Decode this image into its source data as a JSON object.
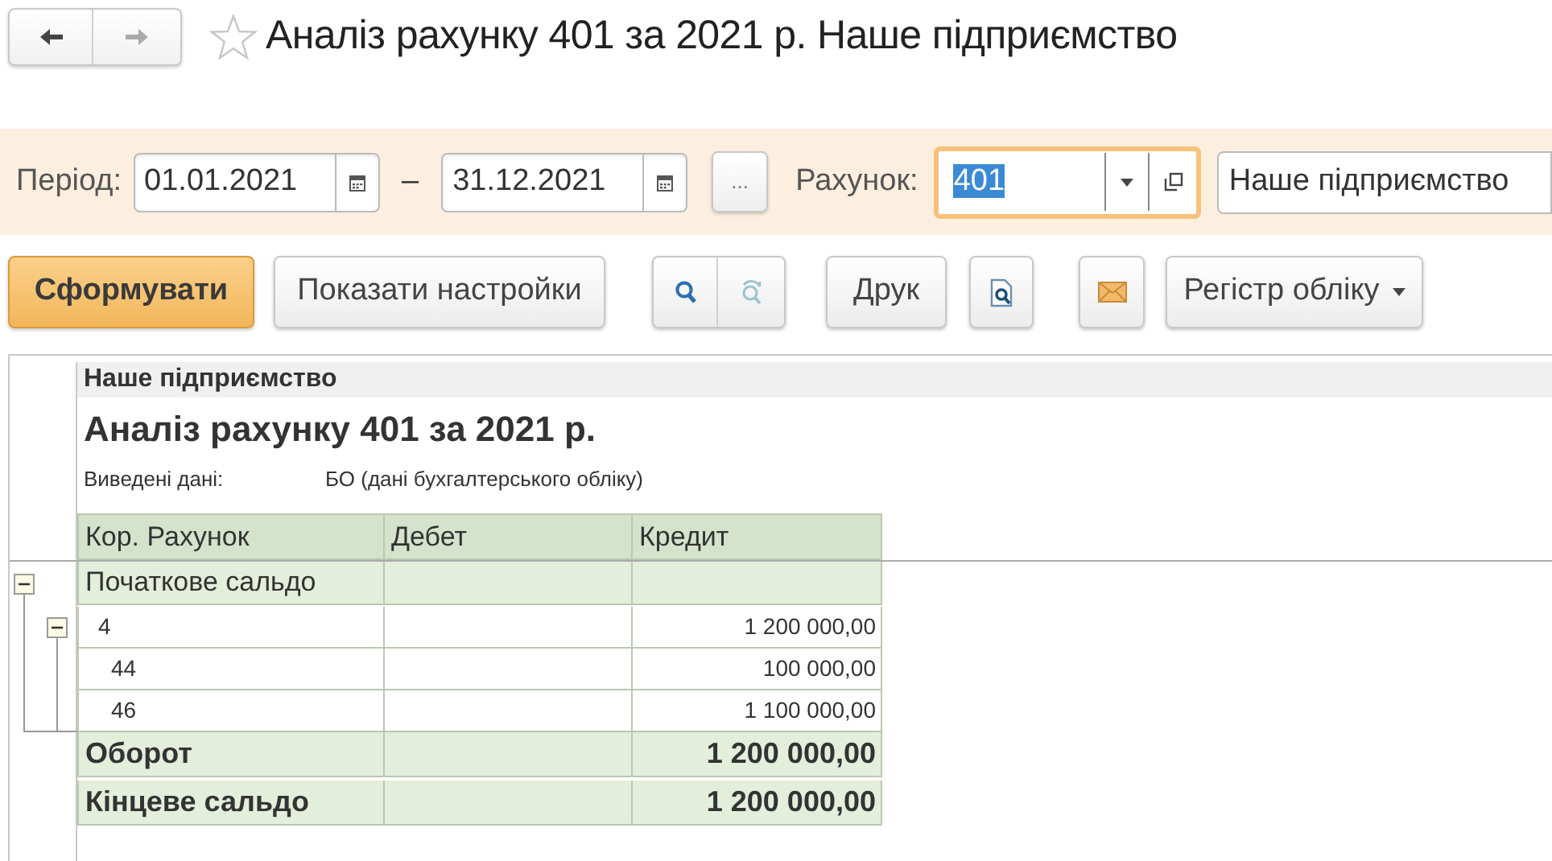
{
  "window": {
    "title": "Аналіз рахунку 401 за 2021 р. Наше підприємство",
    "favorite": false
  },
  "filters": {
    "period_label": "Період:",
    "date_from": "01.01.2021",
    "separator": "–",
    "date_to": "31.12.2021",
    "more_button": "...",
    "account_label": "Рахунок:",
    "account": "401",
    "account_selected": true,
    "organization": "Наше підприємство"
  },
  "toolbar": {
    "generate": "Сформувати",
    "settings": "Показати настройки",
    "print": "Друк",
    "register": "Регістр обліку"
  },
  "report": {
    "organization": "Наше підприємство",
    "title": "Аналіз рахунку 401 за 2021 р.",
    "data_label": "Виведені дані:",
    "data_value": "БО (дані бухгалтерського обліку)",
    "columns": [
      "Кор. Рахунок",
      "Дебет",
      "Кредит"
    ],
    "rows": [
      {
        "kind": "group",
        "account": "Початкове сальдо",
        "expanded": true,
        "children": [
          {
            "kind": "detail",
            "account": "4",
            "credit": "1 200 000,00",
            "expanded": true,
            "children": [
              {
                "kind": "detail",
                "account": "44",
                "credit": "100 000,00"
              },
              {
                "kind": "detail",
                "account": "46",
                "credit": "1 100 000,00"
              }
            ]
          }
        ]
      },
      {
        "kind": "total",
        "account": "Оборот",
        "credit": "1 200 000,00"
      },
      {
        "kind": "total",
        "account": "Кінцеве сальдо",
        "credit": "1 200 000,00"
      }
    ]
  }
}
